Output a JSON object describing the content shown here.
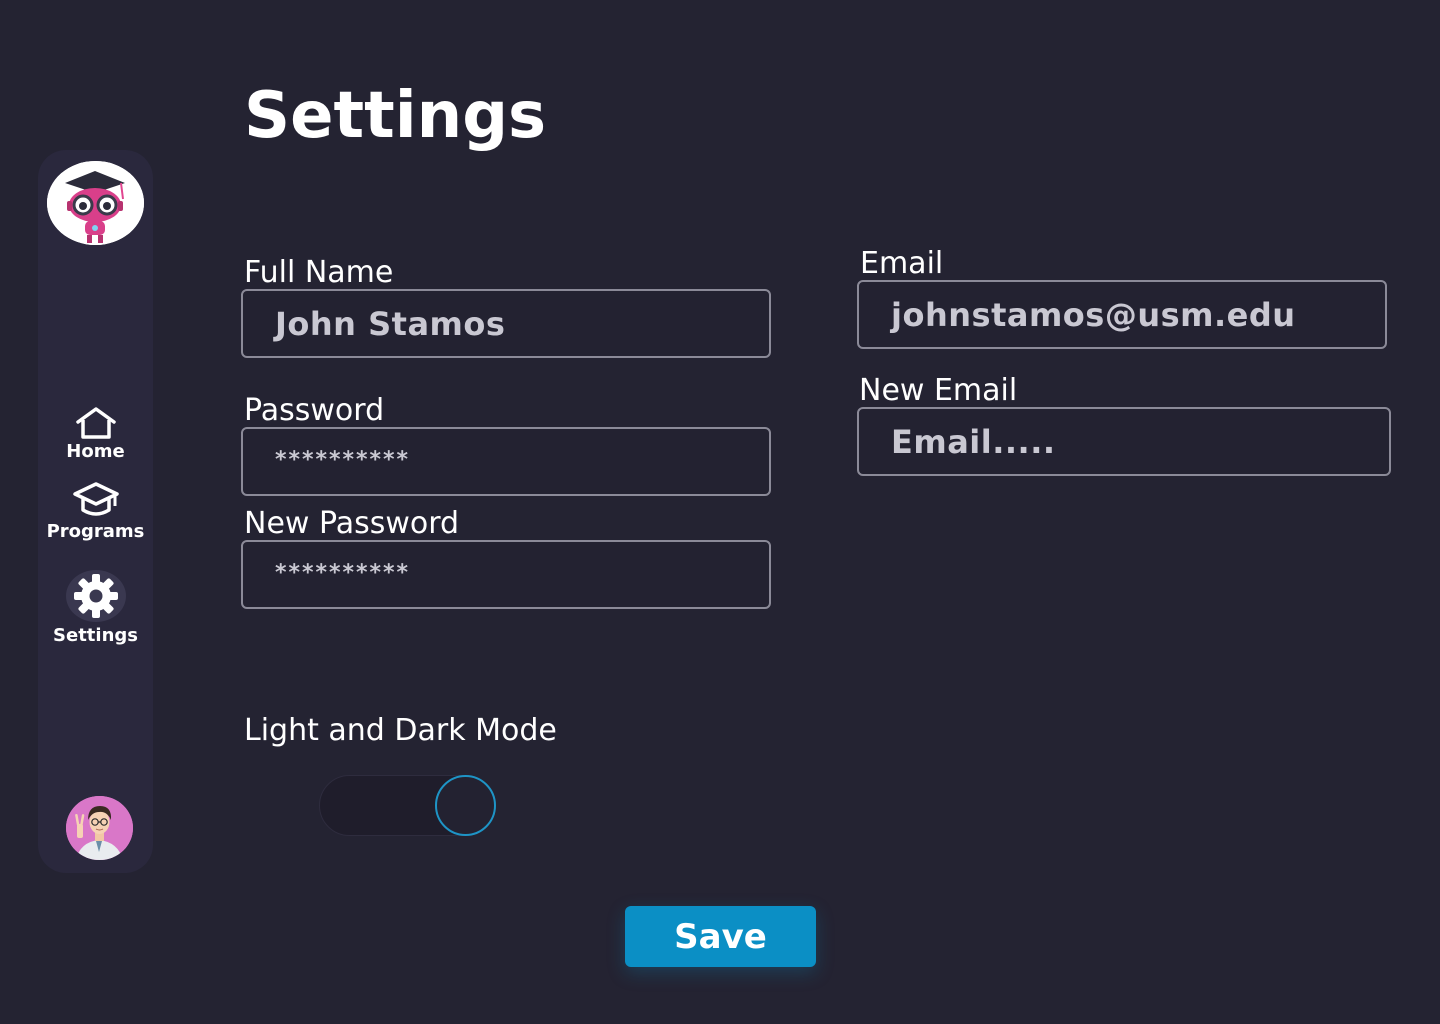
{
  "page": {
    "title": "Settings"
  },
  "sidebar": {
    "logo_icon": "robot-graduate-logo",
    "items": [
      {
        "label": "Home",
        "icon": "home-icon"
      },
      {
        "label": "Programs",
        "icon": "graduation-cap-icon"
      },
      {
        "label": "Settings",
        "icon": "gear-icon",
        "active": true
      }
    ],
    "avatar_icon": "user-avatar"
  },
  "form": {
    "full_name": {
      "label": "Full Name",
      "value": "John Stamos"
    },
    "password": {
      "label": "Password",
      "value": "**********"
    },
    "new_password": {
      "label": "New Password",
      "value": "**********"
    },
    "email": {
      "label": "Email",
      "value": "johnstamos@usm.edu"
    },
    "new_email": {
      "label": "New Email",
      "placeholder": "Email....."
    }
  },
  "theme": {
    "label": "Light and Dark Mode",
    "toggle_state": "on"
  },
  "actions": {
    "save_label": "Save"
  },
  "colors": {
    "background": "#242332",
    "sidebar": "#2a283d",
    "accent": "#0b8fc5",
    "toggle_ring": "#1e94c6",
    "field_border": "#8b8a98"
  }
}
